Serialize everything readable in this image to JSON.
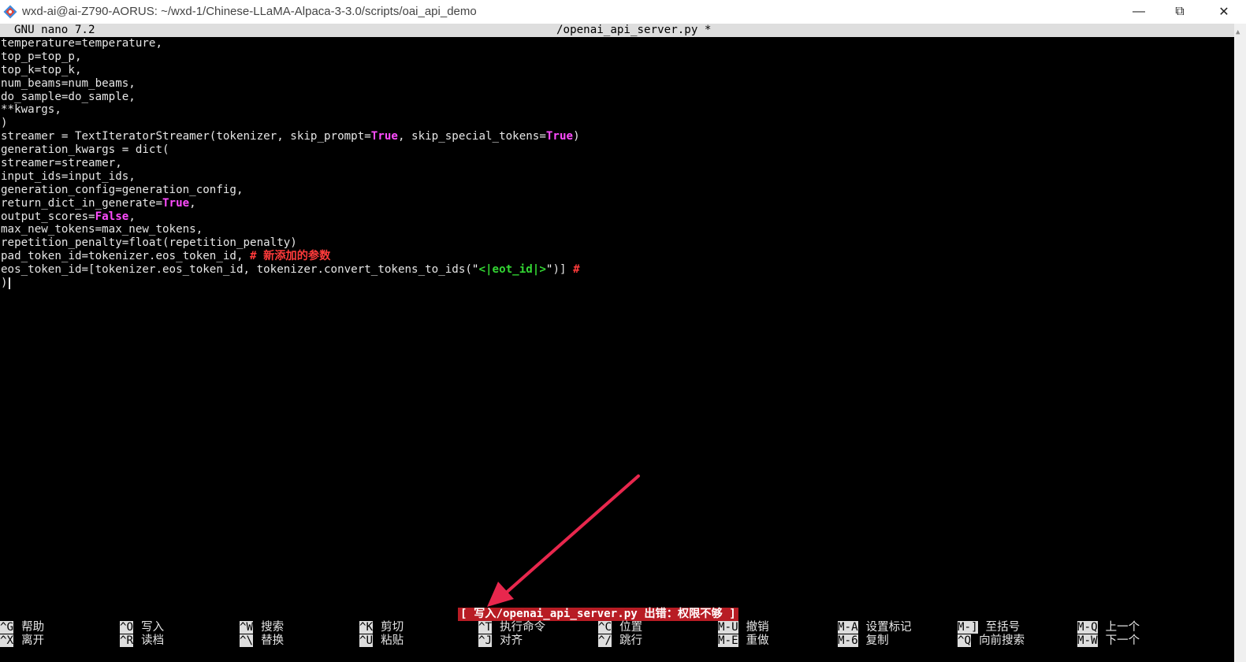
{
  "window": {
    "title": "wxd-ai@ai-Z790-AORUS: ~/wxd-1/Chinese-LLaMA-Alpaca-3-3.0/scripts/oai_api_demo",
    "min_glyph": "—",
    "max_glyph": "⧉",
    "close_glyph": "✕"
  },
  "nano": {
    "version": "GNU nano 7.2",
    "filename": "/openai_api_server.py *"
  },
  "code_lines": [
    [
      {
        "t": "temperature=temperature,"
      }
    ],
    [
      {
        "t": "top_p=top_p,"
      }
    ],
    [
      {
        "t": "top_k=top_k,"
      }
    ],
    [
      {
        "t": "num_beams=num_beams,"
      }
    ],
    [
      {
        "t": "do_sample=do_sample,"
      }
    ],
    [
      {
        "t": "**kwargs,"
      }
    ],
    [
      {
        "t": ")"
      }
    ],
    [
      {
        "t": "streamer = TextIteratorStreamer(tokenizer, skip_prompt="
      },
      {
        "t": "True",
        "c": "kw"
      },
      {
        "t": ", skip_special_tokens="
      },
      {
        "t": "True",
        "c": "kw"
      },
      {
        "t": ")"
      }
    ],
    [
      {
        "t": "generation_kwargs = dict("
      }
    ],
    [
      {
        "t": "streamer=streamer,"
      }
    ],
    [
      {
        "t": "input_ids=input_ids,"
      }
    ],
    [
      {
        "t": "generation_config=generation_config,"
      }
    ],
    [
      {
        "t": "return_dict_in_generate="
      },
      {
        "t": "True",
        "c": "kw"
      },
      {
        "t": ","
      }
    ],
    [
      {
        "t": "output_scores="
      },
      {
        "t": "False",
        "c": "kw"
      },
      {
        "t": ","
      }
    ],
    [
      {
        "t": "max_new_tokens=max_new_tokens,"
      }
    ],
    [
      {
        "t": "repetition_penalty=float(repetition_penalty)"
      }
    ],
    [
      {
        "t": "pad_token_id=tokenizer.eos_token_id, "
      },
      {
        "t": "# 新添加的参数",
        "c": "cm"
      }
    ],
    [
      {
        "t": "eos_token_id=[tokenizer.eos_token_id, tokenizer.convert_tokens_to_ids("
      },
      {
        "t": "\"",
        "c": "strq"
      },
      {
        "t": "<|eot_id|>",
        "c": "str"
      },
      {
        "t": "\"",
        "c": "strq"
      },
      {
        "t": ")] "
      },
      {
        "t": "#",
        "c": "cm"
      }
    ],
    [
      {
        "t": ")"
      }
    ]
  ],
  "status_message": "[ 写入/openai_api_server.py 出错：权限不够 ]",
  "shortcuts": [
    [
      {
        "key": "^G",
        "label": "帮助"
      },
      {
        "key": "^X",
        "label": "离开"
      }
    ],
    [
      {
        "key": "^O",
        "label": "写入"
      },
      {
        "key": "^R",
        "label": "读档"
      }
    ],
    [
      {
        "key": "^W",
        "label": "搜索"
      },
      {
        "key": "^\\",
        "label": "替换"
      }
    ],
    [
      {
        "key": "^K",
        "label": "剪切"
      },
      {
        "key": "^U",
        "label": "粘贴"
      }
    ],
    [
      {
        "key": "^T",
        "label": "执行命令"
      },
      {
        "key": "^J",
        "label": "对齐"
      }
    ],
    [
      {
        "key": "^C",
        "label": "位置"
      },
      {
        "key": "^/",
        "label": "跳行"
      }
    ],
    [
      {
        "key": "M-U",
        "label": "撤销"
      },
      {
        "key": "M-E",
        "label": "重做"
      }
    ],
    [
      {
        "key": "M-A",
        "label": "设置标记"
      },
      {
        "key": "M-6",
        "label": "复制"
      }
    ],
    [
      {
        "key": "M-]",
        "label": "至括号"
      },
      {
        "key": "^Q",
        "label": "向前搜索"
      }
    ],
    [
      {
        "key": "M-Q",
        "label": "上一个"
      },
      {
        "key": "M-W",
        "label": "下一个"
      }
    ]
  ],
  "colors": {
    "keyword": "#ff4cff",
    "comment": "#ff3b3b",
    "string": "#33d633",
    "error_bg": "#b81c24",
    "arrow": "#e8274d"
  }
}
